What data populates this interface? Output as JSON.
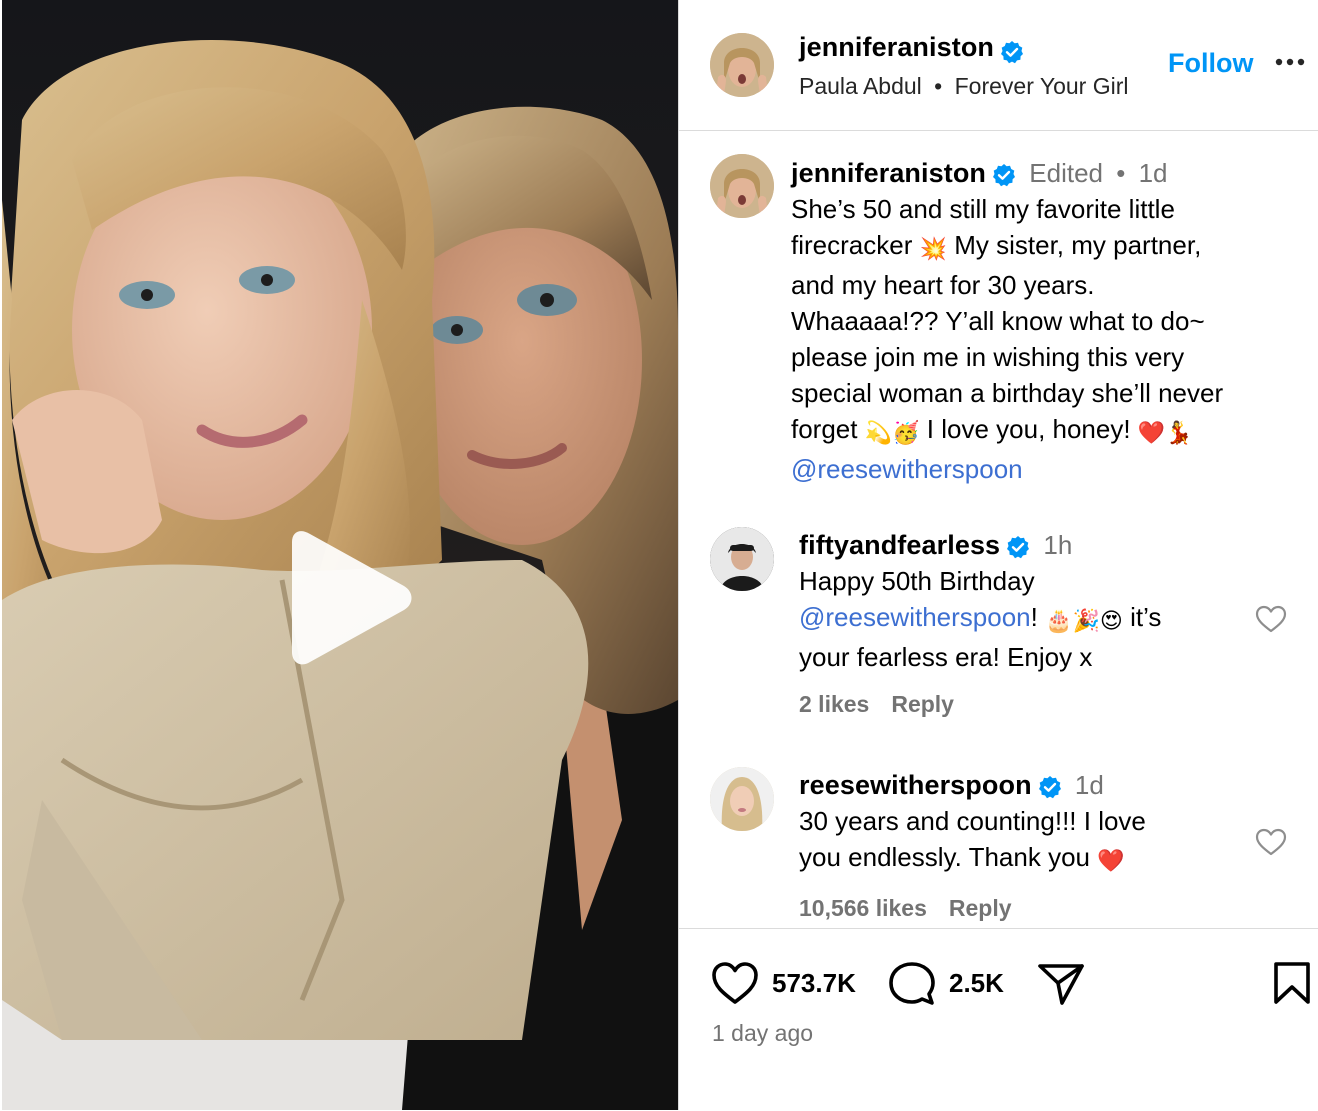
{
  "header": {
    "username": "jenniferaniston",
    "audio_artist": "Paula Abdul",
    "audio_separator": "•",
    "audio_track": "Forever Your Girl",
    "follow_label": "Follow"
  },
  "caption": {
    "username": "jenniferaniston",
    "edited": "Edited",
    "separator": "•",
    "time": "1d",
    "line1": "She’s 50 and still my favorite little",
    "line2a": "firecracker",
    "line2b": "My sister, my partner,",
    "line3": "and my heart for 30 years.",
    "line4": "Whaaaaa!?? Y’all know what to do~",
    "line5": "please join me in wishing this very",
    "line6": "special woman a birthday she’ll never",
    "line7a": "forget",
    "line7b": "I love you, honey!",
    "mention": "@reesewitherspoon"
  },
  "comments": [
    {
      "username": "fiftyandfearless",
      "time": "1h",
      "line1": "Happy 50th Birthday",
      "mention": "@reesewitherspoon",
      "line2_after_mention": "!",
      "line2_end": "it’s",
      "line3": "your fearless era! Enjoy x",
      "likes": "2 likes",
      "reply": "Reply"
    },
    {
      "username": "reesewitherspoon",
      "time": "1d",
      "line1": "30 years and counting!!! I love",
      "line2": "you endlessly. Thank you",
      "likes": "10,566 likes",
      "reply": "Reply"
    }
  ],
  "actions": {
    "like_count": "573.7K",
    "comment_count": "2.5K",
    "posted": "1 day ago"
  },
  "icons": {
    "verified": "verified-badge-icon",
    "heart": "heart-icon",
    "comment": "comment-icon",
    "share": "share-icon",
    "save": "bookmark-icon",
    "play": "play-icon",
    "more": "more-options-icon"
  },
  "colors": {
    "verified": "#0095f6",
    "follow": "#0095f6",
    "mention": "#3d6fd1",
    "meta_gray": "#737373",
    "divider": "#dbdbdb"
  }
}
